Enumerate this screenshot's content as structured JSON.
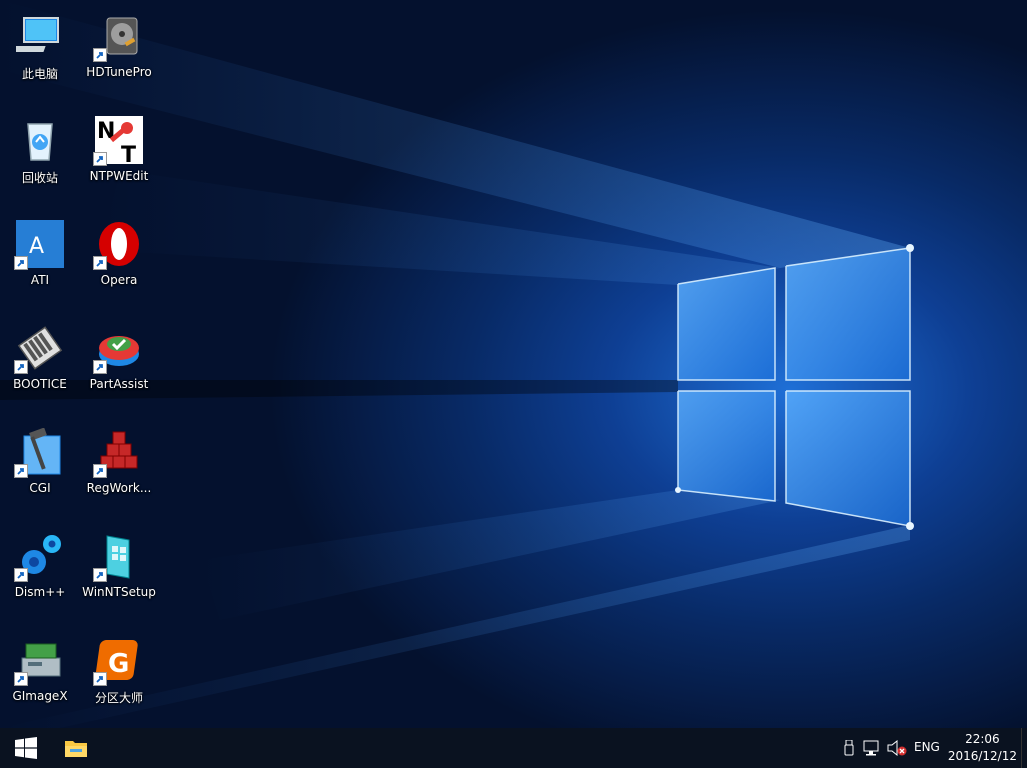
{
  "desktop": {
    "icons": [
      {
        "label": "此电脑",
        "icon": "computer-icon"
      },
      {
        "label": "HDTunePro",
        "icon": "hard-disk-icon"
      },
      {
        "label": "回收站",
        "icon": "recycle-bin-icon"
      },
      {
        "label": "NTPWEdit",
        "icon": "ntpwedit-key-icon"
      },
      {
        "label": "ATI",
        "icon": "ati-icon"
      },
      {
        "label": "Opera",
        "icon": "opera-icon"
      },
      {
        "label": "BOOTICE",
        "icon": "bootice-icon"
      },
      {
        "label": "PartAssist",
        "icon": "partassist-icon"
      },
      {
        "label": "CGI",
        "icon": "cgi-hammer-icon"
      },
      {
        "label": "RegWork...",
        "icon": "regworkshop-cubes-icon"
      },
      {
        "label": "Dism++",
        "icon": "dism-gears-icon"
      },
      {
        "label": "WinNTSetup",
        "icon": "winntsetup-icon"
      },
      {
        "label": "GImageX",
        "icon": "gimagex-drive-icon"
      },
      {
        "label": "分区大师",
        "icon": "diskgenius-icon"
      }
    ]
  },
  "taskbar": {
    "start_icon": "windows-logo-icon",
    "pinned": [
      {
        "icon": "file-explorer-icon"
      }
    ],
    "tray": {
      "icons": [
        "usb-icon",
        "network-disconnected-icon",
        "volume-muted-icon"
      ],
      "language": "ENG",
      "time": "22:06",
      "date": "2016/12/12"
    }
  },
  "colors": {
    "taskbar": "#0a1220",
    "wallpaper_accent": "#1f6fd6",
    "label": "#ffffff"
  }
}
